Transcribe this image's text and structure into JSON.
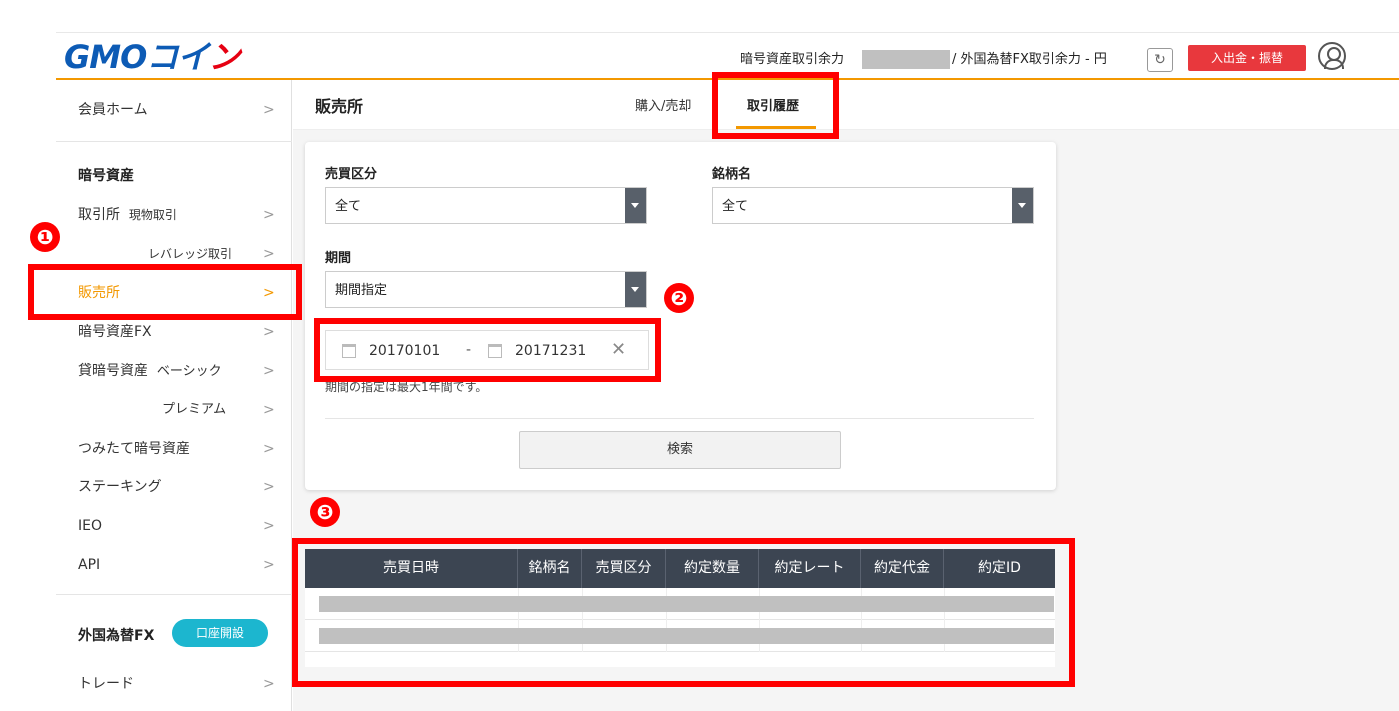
{
  "header": {
    "logo_main": "GMOコイ",
    "logo_accent": "ン",
    "crypto_balance_label": "暗号資産取引余力",
    "fx_balance_label": "/  外国為替FX取引余力 - 円",
    "deposit_button": "入出金・振替",
    "refresh_icon": "↻",
    "accent_color": "#f39800",
    "brand_color": "#0d5bb5"
  },
  "sidebar": {
    "home": "会員ホーム",
    "crypto_heading": "暗号資産",
    "exchange": "取引所",
    "spot": "現物取引",
    "leverage": "レバレッジ取引",
    "sales": "販売所",
    "crypto_fx": "暗号資産FX",
    "lending": "貸暗号資産",
    "basic": "ベーシック",
    "premium": "プレミアム",
    "tsumitate": "つみたて暗号資産",
    "staking": "ステーキング",
    "ieo": "IEO",
    "api": "API",
    "fx_heading": "外国為替FX",
    "open_account": "口座開設",
    "trade": "トレード",
    "chevron": ">"
  },
  "main": {
    "title": "販売所",
    "tabs": [
      {
        "label": "購入/売却"
      },
      {
        "label": "取引履歴"
      }
    ]
  },
  "filters": {
    "side_label": "売買区分",
    "side_value": "全て",
    "symbol_label": "銘柄名",
    "symbol_value": "全て",
    "period_label": "期間",
    "period_value": "期間指定",
    "date_from": "20170101",
    "date_sep": "-",
    "date_to": "20171231",
    "clear": "✕",
    "note": "期間の指定は最大1年間です。",
    "search_button": "検索"
  },
  "table": {
    "columns": [
      "売買日時",
      "銘柄名",
      "売買区分",
      "約定数量",
      "約定レート",
      "約定代金",
      "約定ID"
    ]
  },
  "annotations": {
    "n1": "❶",
    "n2": "❷",
    "n3": "❸"
  }
}
